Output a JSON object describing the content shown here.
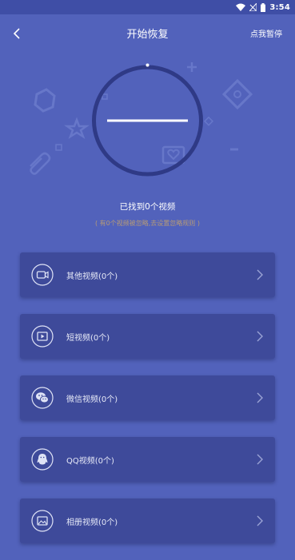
{
  "status_bar": {
    "time": "3:54",
    "icons": [
      "wifi-icon",
      "signal-icon",
      "battery-icon"
    ]
  },
  "header": {
    "back_icon": "back-arrow-icon",
    "title": "开始恢复",
    "pause_label": "点我暂停"
  },
  "scan": {
    "found_text": "已找到0个视频",
    "hint_text": "( 有0个视频被忽略,去设置忽略规则 )"
  },
  "categories": [
    {
      "icon": "camera-icon",
      "label": "其他视频(0个)"
    },
    {
      "icon": "play-icon",
      "label": "短视频(0个)"
    },
    {
      "icon": "wechat-icon",
      "label": "微信视频(0个)"
    },
    {
      "icon": "qq-icon",
      "label": "QQ视频(0个)"
    },
    {
      "icon": "album-icon",
      "label": "相册视频(0个)"
    }
  ],
  "colors": {
    "background": "#5262bb",
    "status_bar": "#3f4ea6",
    "card": "#3e4a9a",
    "ring": "#2f3a86",
    "hint": "#c9a56a"
  }
}
